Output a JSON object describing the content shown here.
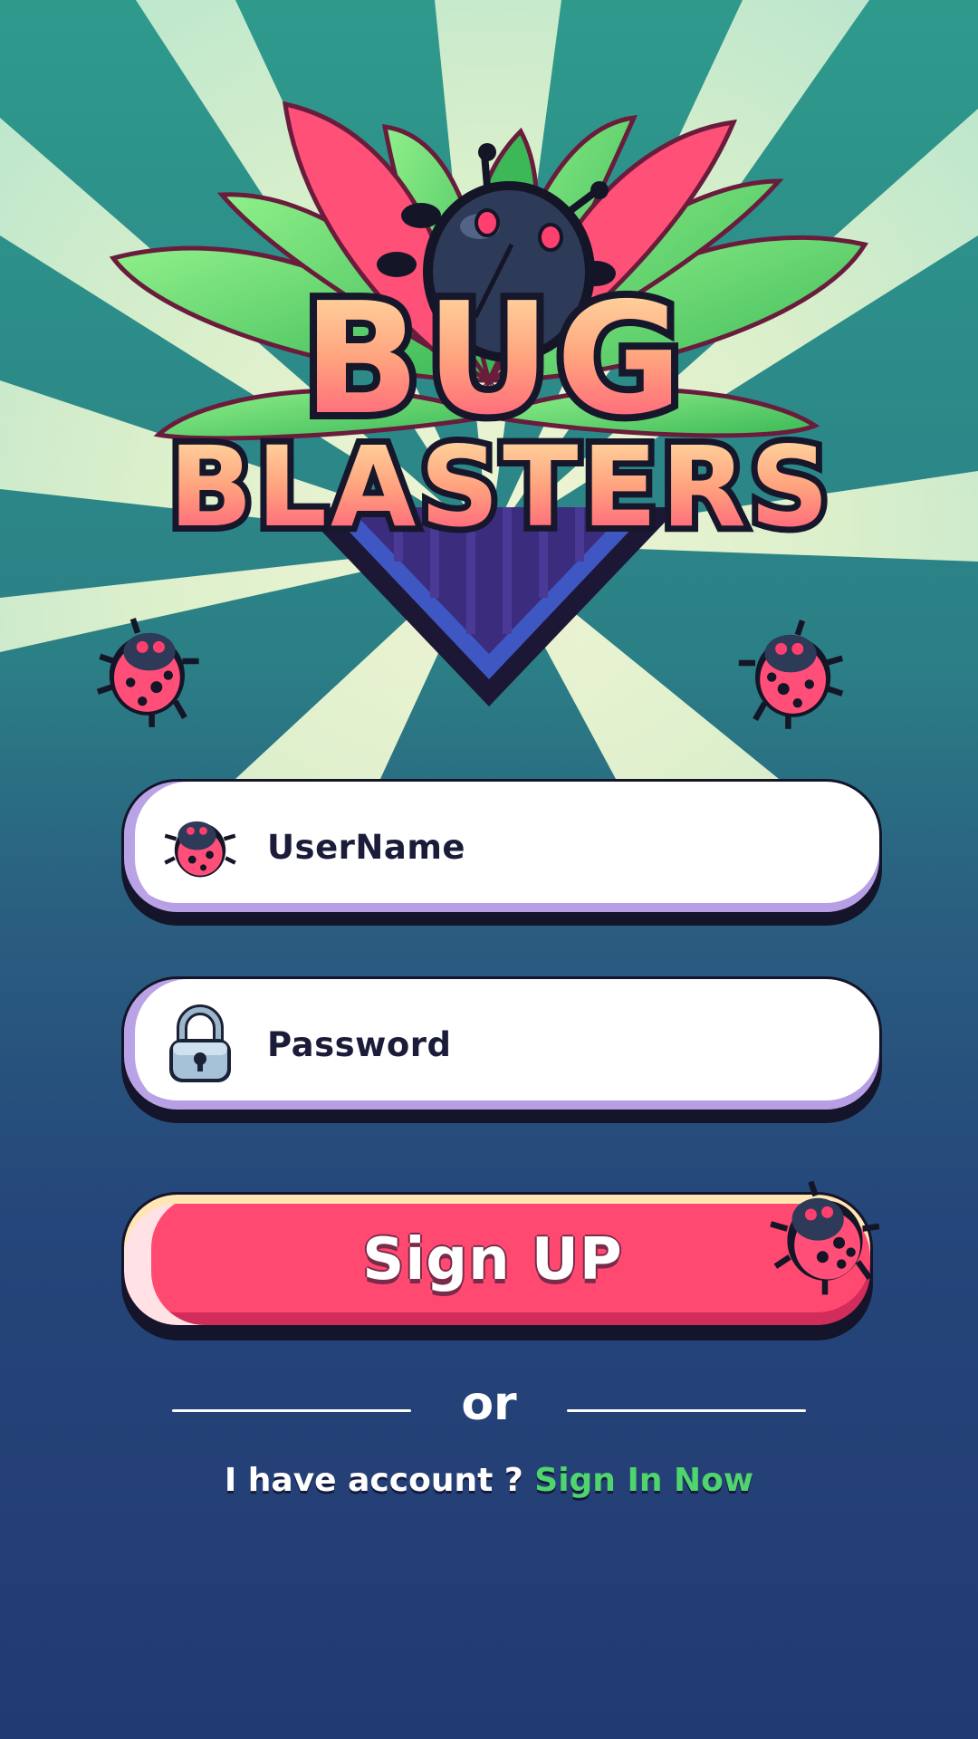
{
  "game": {
    "title_line1": "BUG",
    "title_line2": "BLASTERS"
  },
  "form": {
    "username": {
      "placeholder": "UserName",
      "icon": "ladybug-icon"
    },
    "password": {
      "placeholder": "Password",
      "icon": "padlock-icon"
    },
    "signup_button": {
      "label": "Sign UP",
      "icon": "ladybug-icon"
    }
  },
  "divider": {
    "label": "or"
  },
  "footer": {
    "prompt": "I have account ?",
    "link": "Sign In Now"
  },
  "colors": {
    "background_top": "#2e9a8c",
    "background_bottom": "#223a72",
    "accent_pink": "#ff4970",
    "link_green": "#4fd46e",
    "field_border_lavender": "#b79fe6"
  }
}
